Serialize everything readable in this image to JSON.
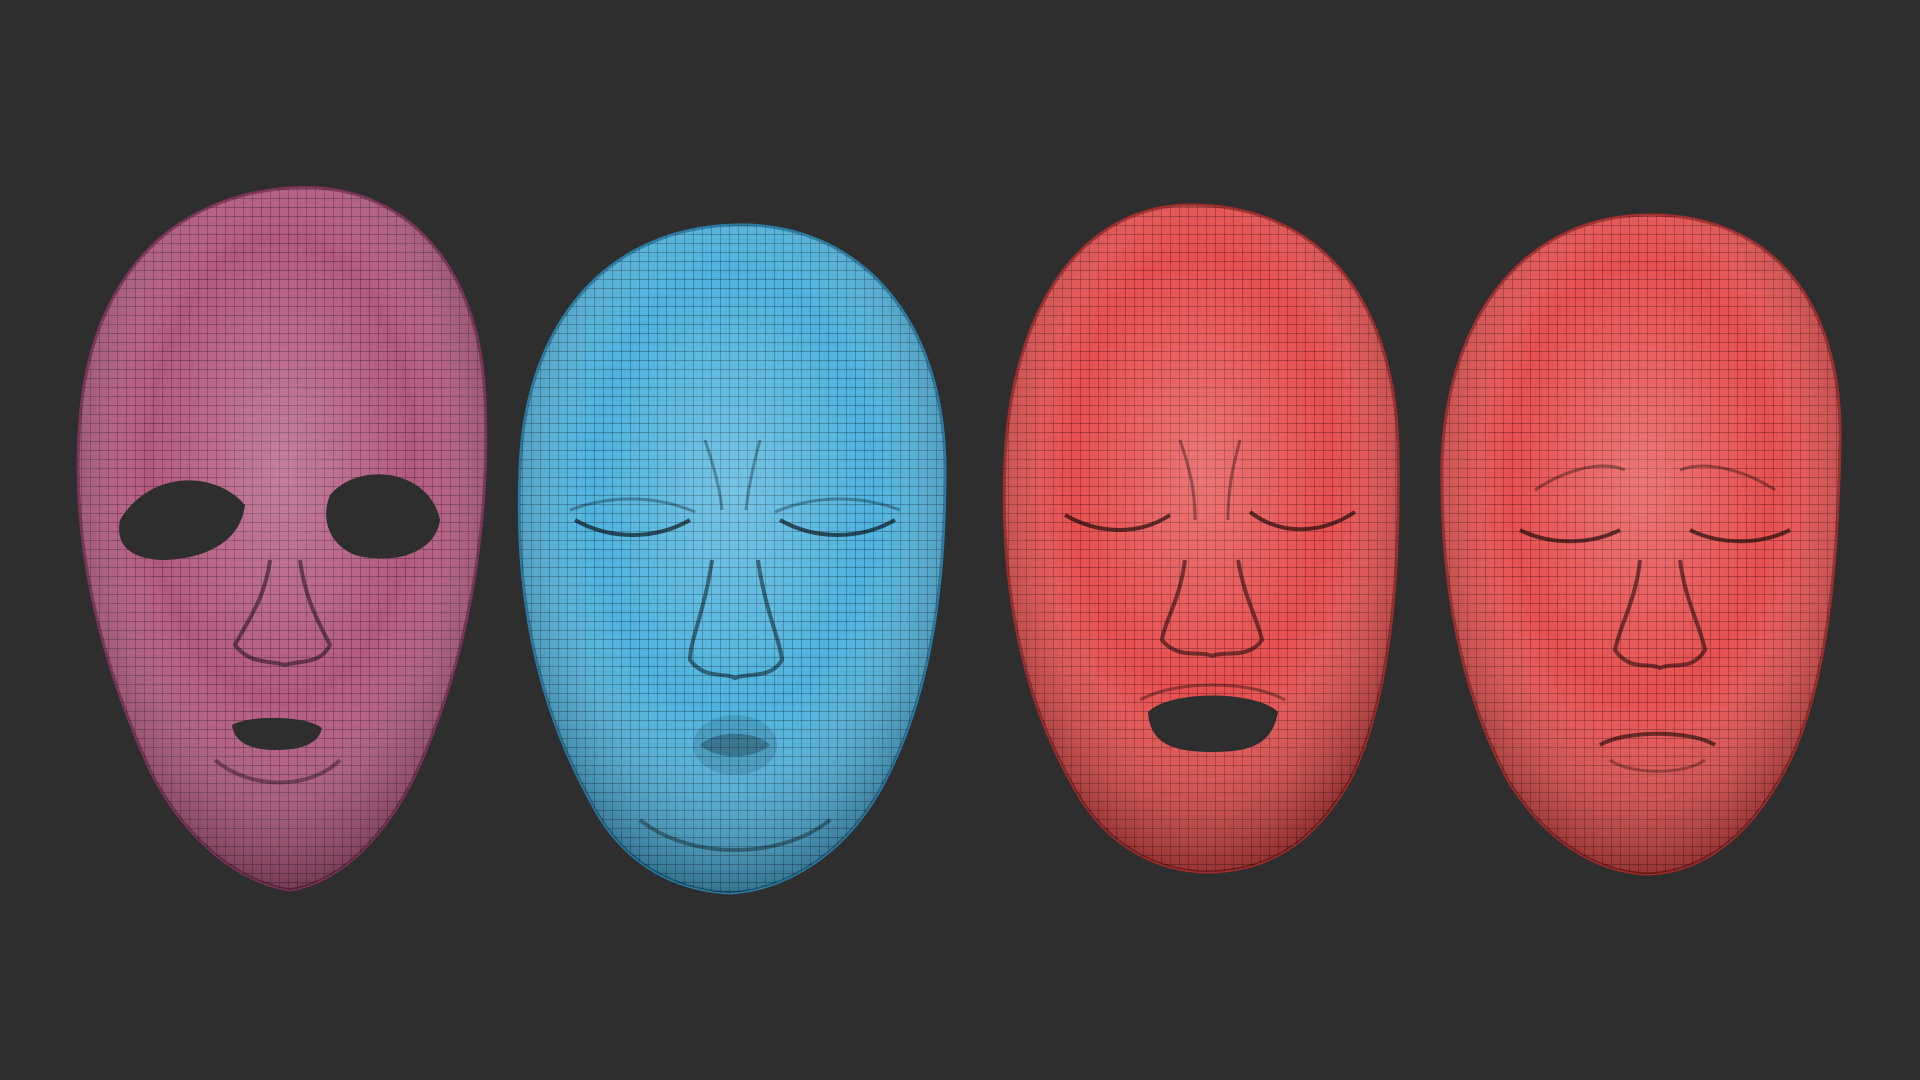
{
  "scene": {
    "background_color": "#2e2e2e",
    "masks": [
      {
        "name": "open-eyes-mask",
        "color": "#b45a82",
        "shade": "#7d3358",
        "eyes": "open",
        "mouth": "open-small"
      },
      {
        "name": "pucker-mask",
        "color": "#4fb3de",
        "shade": "#2a7ca6",
        "eyes": "closed",
        "mouth": "pucker"
      },
      {
        "name": "grimace-mask",
        "color": "#e84f4f",
        "shade": "#a22c2c",
        "eyes": "closed",
        "mouth": "open-wide"
      },
      {
        "name": "sad-mask",
        "color": "#e85050",
        "shade": "#a32d2d",
        "eyes": "closed",
        "mouth": "frown"
      }
    ]
  }
}
